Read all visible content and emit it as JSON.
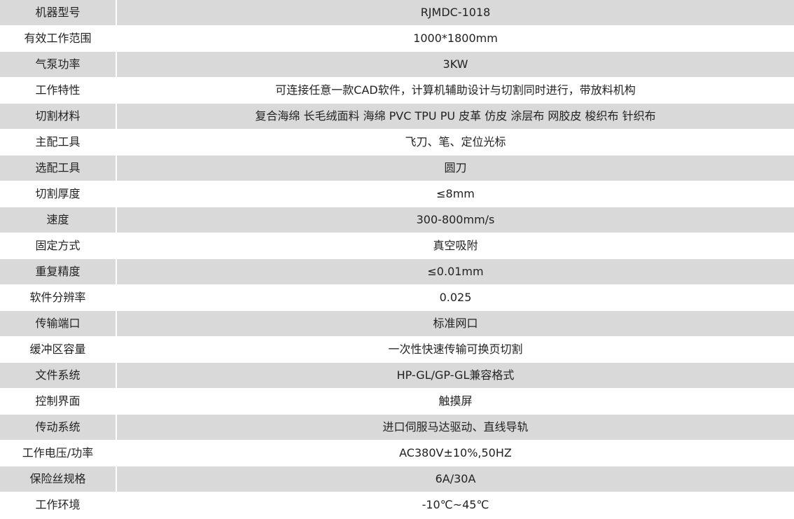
{
  "spec_table": {
    "colors": {
      "shaded_row": "#d9d9d9",
      "plain_row": "#ffffff",
      "text": "#222222"
    },
    "rows": [
      {
        "label": "机器型号",
        "value": "RJMDC-1018"
      },
      {
        "label": "有效工作范围",
        "value": "1000*1800mm"
      },
      {
        "label": "气泵功率",
        "value": "3KW"
      },
      {
        "label": "工作特性",
        "value": "可连接任意一款CAD软件，计算机辅助设计与切割同时进行，带放料机构"
      },
      {
        "label": "切割材料",
        "value": "复合海绵 长毛绒面料 海绵 PVC TPU PU 皮革 仿皮 涂层布 网胶皮 梭织布 针织布"
      },
      {
        "label": "主配工具",
        "value": "飞刀、笔、定位光标"
      },
      {
        "label": "选配工具",
        "value": "圆刀"
      },
      {
        "label": "切割厚度",
        "value": "≤8mm"
      },
      {
        "label": "速度",
        "value": "300-800mm/s"
      },
      {
        "label": "固定方式",
        "value": "真空吸附"
      },
      {
        "label": "重复精度",
        "value": "≤0.01mm"
      },
      {
        "label": "软件分辨率",
        "value": "0.025"
      },
      {
        "label": "传输端口",
        "value": "标准网口"
      },
      {
        "label": "缓冲区容量",
        "value": "一次性快速传输可换页切割"
      },
      {
        "label": "文件系统",
        "value": "HP-GL/GP-GL兼容格式"
      },
      {
        "label": "控制界面",
        "value": "触摸屏"
      },
      {
        "label": "传动系统",
        "value": "进口伺服马达驱动、直线导轨"
      },
      {
        "label": "工作电压/功率",
        "value": "AC380V±10%,50HZ"
      },
      {
        "label": "保险丝规格",
        "value": "6A/30A"
      },
      {
        "label": "工作环境",
        "value": "-10℃~45℃"
      }
    ]
  }
}
